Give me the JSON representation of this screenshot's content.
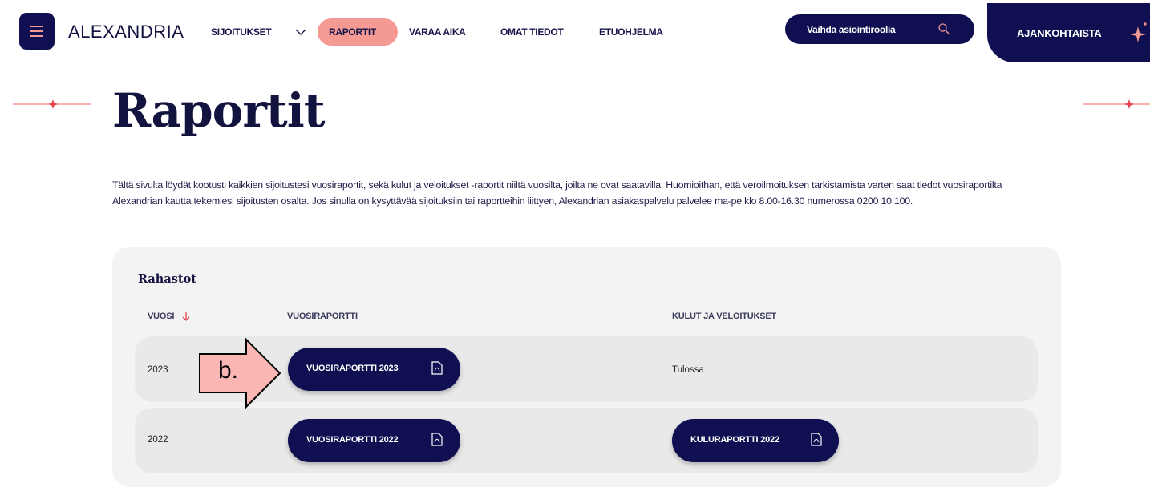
{
  "brand": {
    "name": "ALEXANDRIA",
    "accent": "#f59a93",
    "navy": "#0f0f52"
  },
  "nav": {
    "items": [
      {
        "label": "SIJOITUKSET",
        "has_dropdown": true
      },
      {
        "label": "RAPORTIT",
        "active": true
      },
      {
        "label": "VARAA AIKA"
      },
      {
        "label": "OMAT TIEDOT"
      },
      {
        "label": "ETUOHJELMA"
      }
    ],
    "role_switch": "Vaihda asiointiroolia",
    "news": "AJANKOHTAISTA"
  },
  "page": {
    "title": "Raportit",
    "intro": "Tältä sivulta löydät kootusti kaikkien sijoitustesi vuosiraportit, sekä kulut ja veloitukset -raportit niiltä vuosilta, joilta ne ovat saatavilla. Huomioithan, että veroilmoituksen tarkistamista varten saat tiedot vuosiraportilta Alexandrian kautta tekemiesi sijoitusten osalta. Jos sinulla on kysyttävää sijoituksiin tai raportteihin liittyen, Alexandrian asiakaspalvelu palvelee ma-pe klo 8.00-16.30 numerossa 0200 10 100."
  },
  "reports": {
    "section_title": "Rahastot",
    "columns": {
      "year": "VUOSI",
      "annual": "VUOSIRAPORTTI",
      "costs": "KULUT JA VELOITUKSET"
    },
    "rows": [
      {
        "year": "2023",
        "annual": "VUOSIRAPORTTI 2023",
        "costs_status": "Tulossa"
      },
      {
        "year": "2022",
        "annual": "VUOSIRAPORTTI 2022",
        "costs": "KULURAPORTTI 2022"
      }
    ]
  },
  "annotation": {
    "label": "b."
  }
}
